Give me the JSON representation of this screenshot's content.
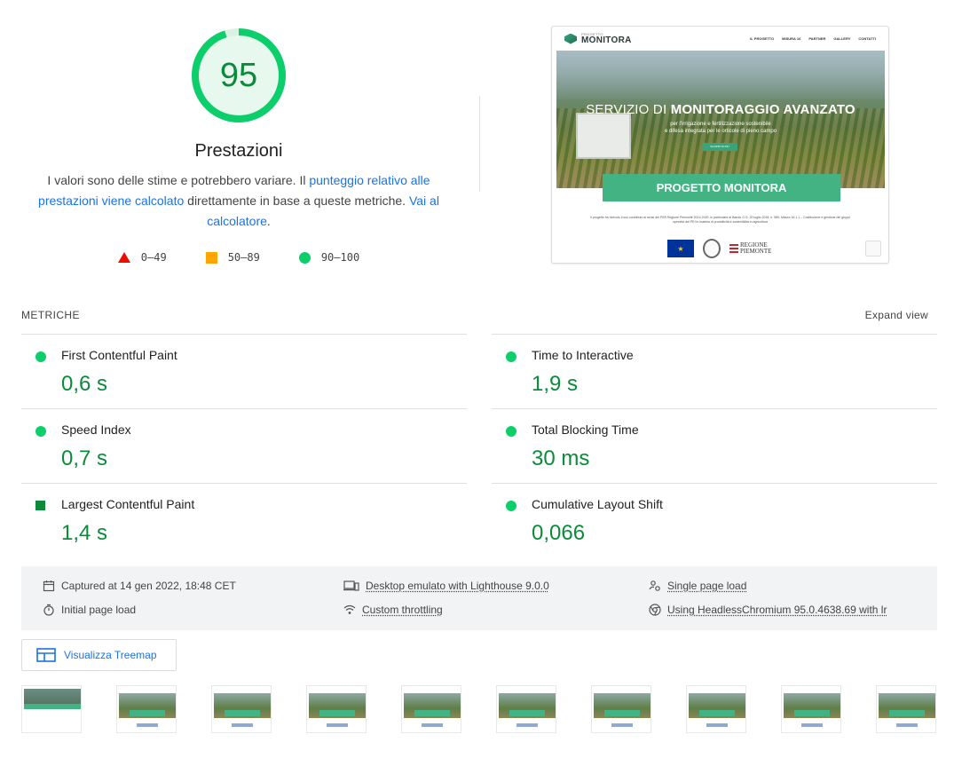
{
  "score": {
    "value": "95",
    "fraction": 0.95,
    "title": "Prestazioni",
    "desc_part1": "I valori sono delle stime e potrebbero variare. Il ",
    "desc_link1": "punteggio relativo alle prestazioni viene calcolato",
    "desc_part2": " direttamente in base a queste metriche. ",
    "desc_link2": "Vai al calcolatore",
    "desc_part3": "."
  },
  "legend": [
    {
      "shape": "triangle",
      "label": "0–49",
      "color": "#eb0f00"
    },
    {
      "shape": "square",
      "label": "50–89",
      "color": "#ffa400"
    },
    {
      "shape": "circle",
      "label": "90–100",
      "color": "#0cce6b"
    }
  ],
  "screenshot": {
    "logo_small": "PROGETTO",
    "logo": "MONITORA",
    "menu": [
      "IL PROGETTO",
      "MISURA 16",
      "PARTNER",
      "GALLERY",
      "CONTATTI"
    ],
    "hero_title_light": "SERVIZIO DI ",
    "hero_title_bold": "MONITORAGGIO AVANZATO",
    "hero_sub_1": "per l'irrigazione e fertilizzazione sostenibile",
    "hero_sub_2": "e difesa integrata per le orticole di pieno campo",
    "hero_button": "SCOPRI DI PIÙ",
    "banner": "PROGETTO MONITORA",
    "small_text": "Il progetto ha ricevuto il suo contributo ai sensi del PSR Regione Piemonte 2014-2020, in particolare al Bando O.G. 20 luglio 2018, n. 580, Misura 16.1.1 – Costituzione e gestione dei gruppi operativi del PEI in materia di produttività e sostenibilità in agricoltura",
    "regione_1": "REGIONE",
    "regione_2": "PIEMONTE"
  },
  "metrics": {
    "header": "METRICHE",
    "expand": "Expand view",
    "items": [
      {
        "name": "First Contentful Paint",
        "value": "0,6 s"
      },
      {
        "name": "Time to Interactive",
        "value": "1,9 s"
      },
      {
        "name": "Speed Index",
        "value": "0,7 s"
      },
      {
        "name": "Total Blocking Time",
        "value": "30 ms"
      },
      {
        "name": "Largest Contentful Paint",
        "value": "1,4 s"
      },
      {
        "name": "Cumulative Layout Shift",
        "value": "0,066"
      }
    ]
  },
  "runtime": {
    "captured": "Captured at 14 gen 2022, 18:48 CET",
    "initial": "Initial page load",
    "device": "Desktop emulato with Lighthouse 9.0.0",
    "throttling": "Custom throttling",
    "single": "Single page load",
    "browser": "Using HeadlessChromium 95.0.4638.69 with lr"
  },
  "treemap_label": "Visualizza Treemap",
  "colors": {
    "pass": "#0cce6b",
    "pass_text": "#0c8a3a",
    "average": "#ffa400",
    "fail": "#eb0f00",
    "link": "#1a73e8"
  }
}
